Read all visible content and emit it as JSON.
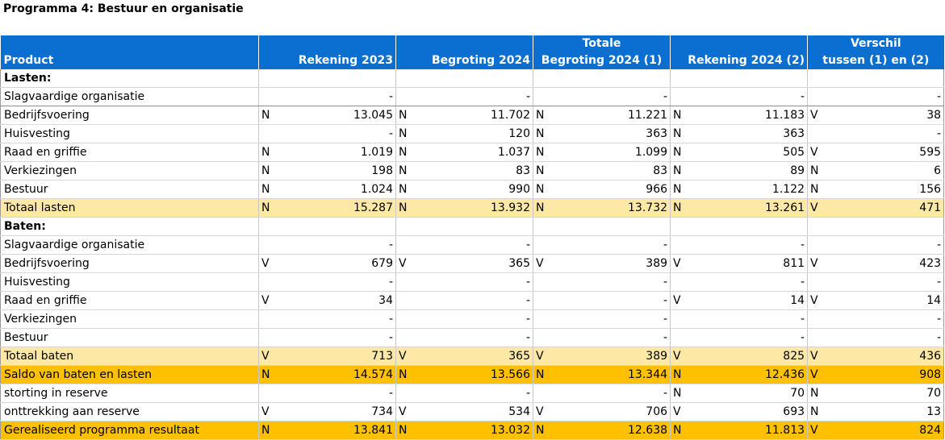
{
  "title": "Programma 4: Bestuur en organisatie",
  "columns": {
    "product": "Product",
    "c1": [
      "",
      "Rekening 2023"
    ],
    "c2": [
      "",
      "Begroting 2024"
    ],
    "c3": [
      "Totale",
      "Begroting 2024 (1)"
    ],
    "c4": [
      "",
      "Rekening 2024 (2)"
    ],
    "c5": [
      "Verschil",
      "tussen (1) en (2)"
    ]
  },
  "rows": [
    {
      "type": "sec",
      "label": "Lasten:",
      "cells": [
        [
          "",
          ""
        ],
        [
          "",
          ""
        ],
        [
          "",
          ""
        ],
        [
          "",
          ""
        ],
        [
          "",
          ""
        ]
      ]
    },
    {
      "type": "row",
      "label": "Slagvaardige organisatie",
      "cells": [
        [
          "",
          "-"
        ],
        [
          "",
          "-"
        ],
        [
          "",
          "-"
        ],
        [
          "",
          "-"
        ],
        [
          "",
          "-"
        ]
      ]
    },
    {
      "type": "row",
      "label": "Bedrijfsvoering",
      "cells": [
        [
          "N",
          "13.045"
        ],
        [
          "N",
          "11.702"
        ],
        [
          "N",
          "11.221"
        ],
        [
          "N",
          "11.183"
        ],
        [
          "V",
          "38"
        ]
      ]
    },
    {
      "type": "row",
      "label": "Huisvesting",
      "cells": [
        [
          "",
          "-"
        ],
        [
          "N",
          "120"
        ],
        [
          "N",
          "363"
        ],
        [
          "N",
          "363"
        ],
        [
          "",
          "-"
        ]
      ]
    },
    {
      "type": "row",
      "label": "Raad en griffie",
      "cells": [
        [
          "N",
          "1.019"
        ],
        [
          "N",
          "1.037"
        ],
        [
          "N",
          "1.099"
        ],
        [
          "N",
          "505"
        ],
        [
          "V",
          "595"
        ]
      ]
    },
    {
      "type": "row",
      "label": "Verkiezingen",
      "cells": [
        [
          "N",
          "198"
        ],
        [
          "N",
          "83"
        ],
        [
          "N",
          "83"
        ],
        [
          "N",
          "89"
        ],
        [
          "N",
          "6"
        ]
      ]
    },
    {
      "type": "row",
      "label": "Bestuur",
      "cells": [
        [
          "N",
          "1.024"
        ],
        [
          "N",
          "990"
        ],
        [
          "N",
          "966"
        ],
        [
          "N",
          "1.122"
        ],
        [
          "N",
          "156"
        ]
      ]
    },
    {
      "type": "total",
      "label": "Totaal lasten",
      "cells": [
        [
          "N",
          "15.287"
        ],
        [
          "N",
          "13.932"
        ],
        [
          "N",
          "13.732"
        ],
        [
          "N",
          "13.261"
        ],
        [
          "V",
          "471"
        ]
      ]
    },
    {
      "type": "sec",
      "label": "Baten:",
      "cells": [
        [
          "",
          ""
        ],
        [
          "",
          ""
        ],
        [
          "",
          ""
        ],
        [
          "",
          ""
        ],
        [
          "",
          ""
        ]
      ]
    },
    {
      "type": "row",
      "label": "Slagvaardige organisatie",
      "cells": [
        [
          "",
          "-"
        ],
        [
          "",
          "-"
        ],
        [
          "",
          "-"
        ],
        [
          "",
          "-"
        ],
        [
          "",
          "-"
        ]
      ]
    },
    {
      "type": "row",
      "label": "Bedrijfsvoering",
      "cells": [
        [
          "V",
          "679"
        ],
        [
          "V",
          "365"
        ],
        [
          "V",
          "389"
        ],
        [
          "V",
          "811"
        ],
        [
          "V",
          "423"
        ]
      ]
    },
    {
      "type": "row",
      "label": "Huisvesting",
      "cells": [
        [
          "",
          "-"
        ],
        [
          "",
          "-"
        ],
        [
          "",
          "-"
        ],
        [
          "",
          "-"
        ],
        [
          "",
          "-"
        ]
      ]
    },
    {
      "type": "row",
      "label": "Raad en griffie",
      "cells": [
        [
          "V",
          "34"
        ],
        [
          "",
          "-"
        ],
        [
          "",
          "-"
        ],
        [
          "V",
          "14"
        ],
        [
          "V",
          "14"
        ]
      ]
    },
    {
      "type": "row",
      "label": "Verkiezingen",
      "cells": [
        [
          "",
          "-"
        ],
        [
          "",
          "-"
        ],
        [
          "",
          "-"
        ],
        [
          "",
          "-"
        ],
        [
          "",
          "-"
        ]
      ]
    },
    {
      "type": "row",
      "label": "Bestuur",
      "cells": [
        [
          "",
          "-"
        ],
        [
          "",
          "-"
        ],
        [
          "",
          "-"
        ],
        [
          "",
          "-"
        ],
        [
          "",
          "-"
        ]
      ]
    },
    {
      "type": "total",
      "label": "Totaal baten",
      "cells": [
        [
          "V",
          "713"
        ],
        [
          "V",
          "365"
        ],
        [
          "V",
          "389"
        ],
        [
          "V",
          "825"
        ],
        [
          "V",
          "436"
        ]
      ]
    },
    {
      "type": "saldo",
      "label": "Saldo van baten en lasten",
      "cells": [
        [
          "N",
          "14.574"
        ],
        [
          "N",
          "13.566"
        ],
        [
          "N",
          "13.344"
        ],
        [
          "N",
          "12.436"
        ],
        [
          "V",
          "908"
        ]
      ]
    },
    {
      "type": "row",
      "label": "storting in reserve",
      "cells": [
        [
          "",
          "-"
        ],
        [
          "",
          "-"
        ],
        [
          "",
          "-"
        ],
        [
          "N",
          "70"
        ],
        [
          "N",
          "70"
        ]
      ]
    },
    {
      "type": "row",
      "label": "onttrekking aan reserve",
      "cells": [
        [
          "V",
          "734"
        ],
        [
          "V",
          "534"
        ],
        [
          "V",
          "706"
        ],
        [
          "V",
          "693"
        ],
        [
          "N",
          "13"
        ]
      ]
    },
    {
      "type": "result",
      "label": "Gerealiseerd programma resultaat",
      "cells": [
        [
          "N",
          "13.841"
        ],
        [
          "N",
          "13.032"
        ],
        [
          "N",
          "12.638"
        ],
        [
          "N",
          "11.813"
        ],
        [
          "V",
          "824"
        ]
      ]
    }
  ]
}
